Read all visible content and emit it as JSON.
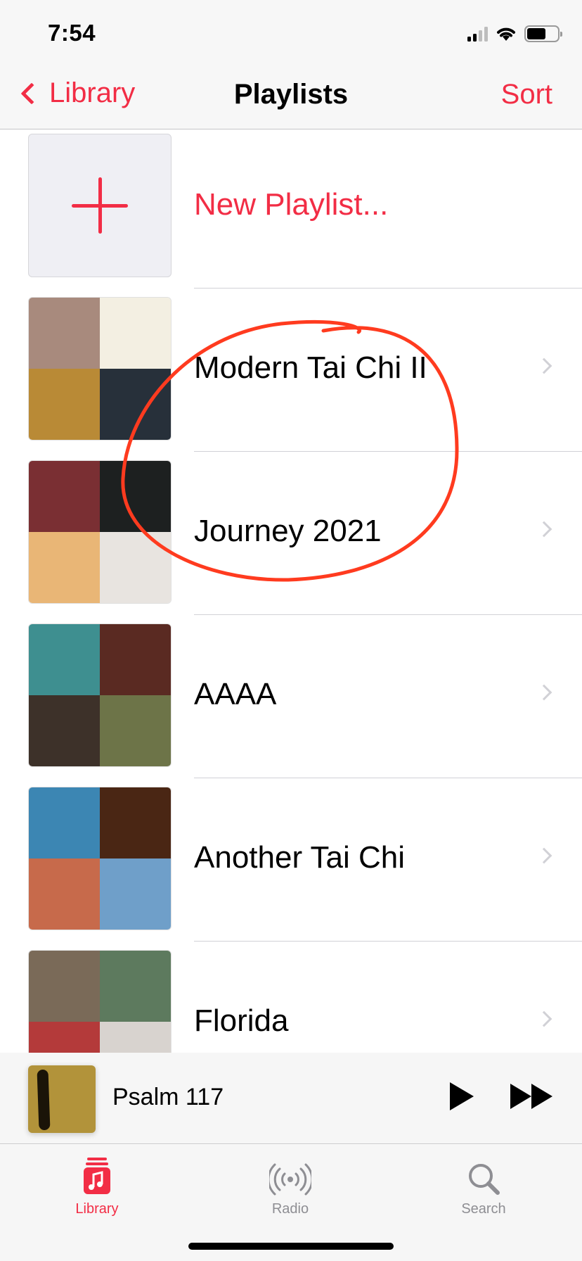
{
  "status_bar": {
    "time": "7:54"
  },
  "nav": {
    "back_label": "Library",
    "title": "Playlists",
    "sort_label": "Sort"
  },
  "new_playlist": {
    "label": "New Playlist..."
  },
  "playlists": [
    {
      "title": "Modern Tai Chi II",
      "art": [
        "#a88a7d",
        "#f3efe2",
        "#b98a36",
        "#27303a"
      ]
    },
    {
      "title": "Journey 2021",
      "art": [
        "#7a2f33",
        "#1d2020",
        "#e9b676",
        "#e8e4e0"
      ]
    },
    {
      "title": "AAAA",
      "art": [
        "#3e8f90",
        "#5a2a22",
        "#3d3129",
        "#6d7448"
      ]
    },
    {
      "title": "Another Tai Chi",
      "art": [
        "#3c86b3",
        "#4a2614",
        "#c76a4b",
        "#6f9fc9"
      ]
    },
    {
      "title": "Florida",
      "art": [
        "#7a6a58",
        "#5d7a5e",
        "#b43a3a",
        "#d8d3cf"
      ]
    }
  ],
  "annotation": {
    "color": "#ff3b1f",
    "target": "Journey 2021"
  },
  "now_playing": {
    "title": "Psalm 117"
  },
  "tabs": [
    {
      "label": "Library",
      "icon": "music-note-icon",
      "active": true
    },
    {
      "label": "Radio",
      "icon": "radio-broadcast-icon",
      "active": false
    },
    {
      "label": "Search",
      "icon": "search-icon",
      "active": false
    }
  ],
  "colors": {
    "accent": "#f22d45",
    "inactive": "#8e8e93"
  }
}
